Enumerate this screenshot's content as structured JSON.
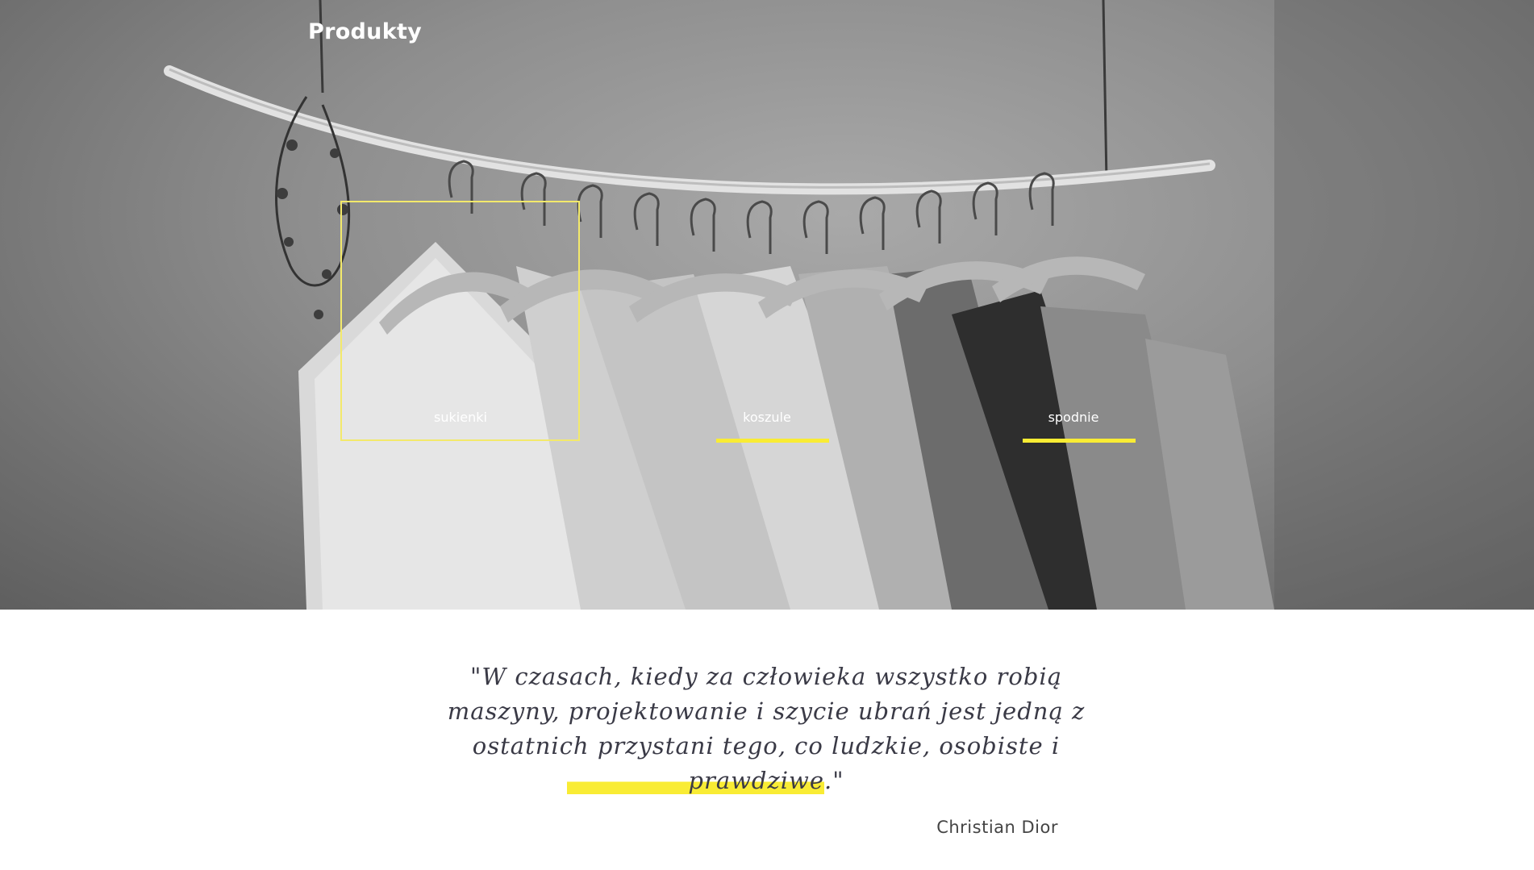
{
  "hero": {
    "title": "Produkty",
    "categories": [
      {
        "label": "sukienki"
      },
      {
        "label": "koszule"
      },
      {
        "label": "spodnie"
      }
    ]
  },
  "quote": {
    "line1": "\"W czasach, kiedy za człowieka wszystko robią",
    "line2": "maszyny, projektowanie i szycie ubrań jest jedną z",
    "line3": "ostatnich przystani tego, co ludzkie, osobiste i",
    "highlight": "prawdziwe",
    "end": ".\"",
    "author": "Christian Dior"
  },
  "colors": {
    "accent": "#f9ec34",
    "box_border": "#f3e96b",
    "quote_text": "#3a3a46"
  }
}
